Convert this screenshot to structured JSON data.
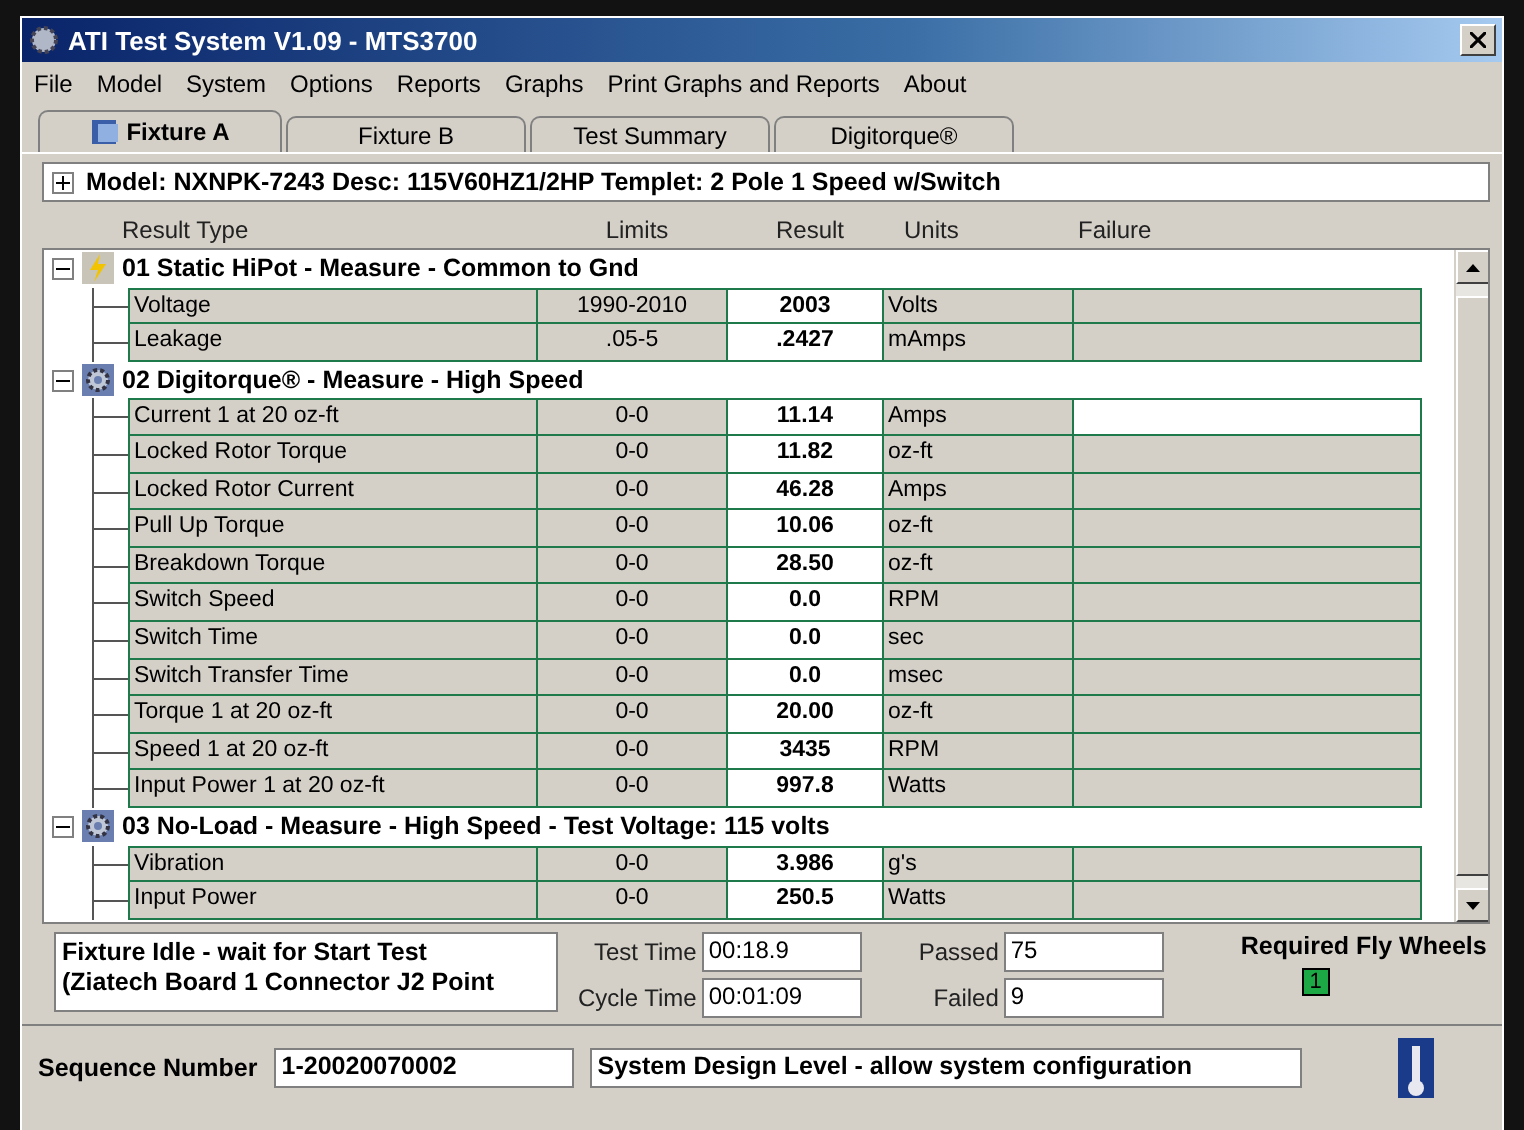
{
  "window": {
    "title": "ATI Test System V1.09 - MTS3700"
  },
  "menu": [
    {
      "label": "File"
    },
    {
      "label": "Model"
    },
    {
      "label": "System"
    },
    {
      "label": "Options"
    },
    {
      "label": "Reports"
    },
    {
      "label": "Graphs"
    },
    {
      "label": "Print Graphs and Reports"
    },
    {
      "label": "About"
    }
  ],
  "tabs": [
    {
      "label": "Fixture A",
      "selected": true
    },
    {
      "label": "Fixture B",
      "selected": false
    },
    {
      "label": "Test Summary",
      "selected": false
    },
    {
      "label": "Digitorque®",
      "selected": false
    }
  ],
  "model": {
    "text": "Model: NXNPK-7243  Desc: 115V60HZ1/2HP  Templet: 2 Pole 1 Speed w/Switch",
    "expanded": false
  },
  "columns": [
    "Result Type",
    "Limits",
    "Result",
    "Units",
    "Failure"
  ],
  "groups": [
    {
      "title": "01 Static HiPot - Measure - Common to Gnd",
      "kind": "hipot",
      "expanded": true,
      "rows": [
        {
          "name": "Voltage",
          "limits": "1990-2010",
          "result": "2003",
          "units": "Volts",
          "selected": false
        },
        {
          "name": "Leakage",
          "limits": ".05-5",
          "result": ".2427",
          "units": "mAmps",
          "selected": false
        }
      ]
    },
    {
      "title": "02 Digitorque® - Measure - High Speed",
      "kind": "motor",
      "expanded": true,
      "rows": [
        {
          "name": "Current 1 at 20 oz-ft",
          "limits": "0-0",
          "result": "11.14",
          "units": "Amps",
          "selected": true
        },
        {
          "name": "Locked Rotor Torque",
          "limits": "0-0",
          "result": "11.82",
          "units": "oz-ft",
          "selected": false
        },
        {
          "name": "Locked Rotor Current",
          "limits": "0-0",
          "result": "46.28",
          "units": "Amps",
          "selected": false
        },
        {
          "name": "Pull Up Torque",
          "limits": "0-0",
          "result": "10.06",
          "units": "oz-ft",
          "selected": false
        },
        {
          "name": "Breakdown Torque",
          "limits": "0-0",
          "result": "28.50",
          "units": "oz-ft",
          "selected": false
        },
        {
          "name": "Switch Speed",
          "limits": "0-0",
          "result": "0.0",
          "units": "RPM",
          "selected": false
        },
        {
          "name": "Switch Time",
          "limits": "0-0",
          "result": "0.0",
          "units": "sec",
          "selected": false
        },
        {
          "name": "Switch Transfer Time",
          "limits": "0-0",
          "result": "0.0",
          "units": "msec",
          "selected": false
        },
        {
          "name": "Torque 1 at 20 oz-ft",
          "limits": "0-0",
          "result": "20.00",
          "units": "oz-ft",
          "selected": false
        },
        {
          "name": "Speed 1 at 20 oz-ft",
          "limits": "0-0",
          "result": "3435",
          "units": "RPM",
          "selected": false
        },
        {
          "name": "Input Power 1 at 20 oz-ft",
          "limits": "0-0",
          "result": "997.8",
          "units": "Watts",
          "selected": false
        }
      ]
    },
    {
      "title": "03 No-Load - Measure - High Speed - Test Voltage: 115 volts",
      "kind": "motor",
      "expanded": true,
      "rows": [
        {
          "name": "Vibration",
          "limits": "0-0",
          "result": "3.986",
          "units": "g's",
          "selected": false
        },
        {
          "name": "Input Power",
          "limits": "0-0",
          "result": "250.5",
          "units": "Watts",
          "selected": false
        }
      ]
    }
  ],
  "status": {
    "message": [
      "Fixture Idle - wait for Start Test",
      "(Ziatech Board 1 Connector J2 Point"
    ],
    "test_time_label": "Test Time",
    "test_time": "00:18.9",
    "cycle_time_label": "Cycle Time",
    "cycle_time": "00:01:09",
    "passed_label": "Passed",
    "passed": "75",
    "failed_label": "Failed",
    "failed": "9",
    "fly_wheels_label": "Required Fly Wheels",
    "fly_wheels": "1"
  },
  "footer": {
    "sequence_label": "Sequence Number",
    "sequence": "1-20020070002",
    "level": "System Design Level - allow system configuration"
  }
}
